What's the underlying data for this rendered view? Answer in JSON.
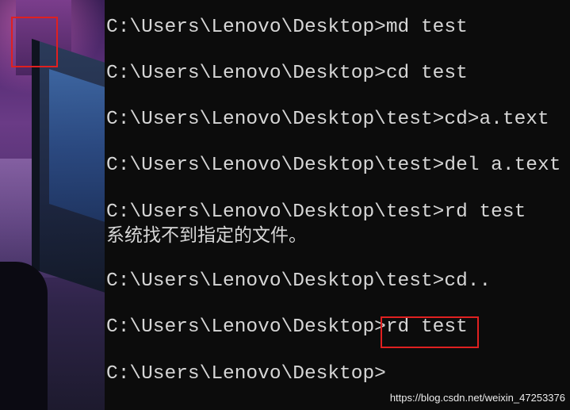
{
  "terminal": {
    "lines": [
      "C:\\Users\\Lenovo\\Desktop>md test",
      "C:\\Users\\Lenovo\\Desktop>cd test",
      "C:\\Users\\Lenovo\\Desktop\\test>cd>a.text",
      "C:\\Users\\Lenovo\\Desktop\\test>del a.text",
      "C:\\Users\\Lenovo\\Desktop\\test>rd test",
      "系统找不到指定的文件。",
      "C:\\Users\\Lenovo\\Desktop\\test>cd..",
      "C:\\Users\\Lenovo\\Desktop>rd test",
      "C:\\Users\\Lenovo\\Desktop>"
    ]
  },
  "watermark": "https://blog.csdn.net/weixin_47253376",
  "colors": {
    "background": "#0c0c0c",
    "text": "#d6d6d6",
    "annotation": "#e02020"
  }
}
